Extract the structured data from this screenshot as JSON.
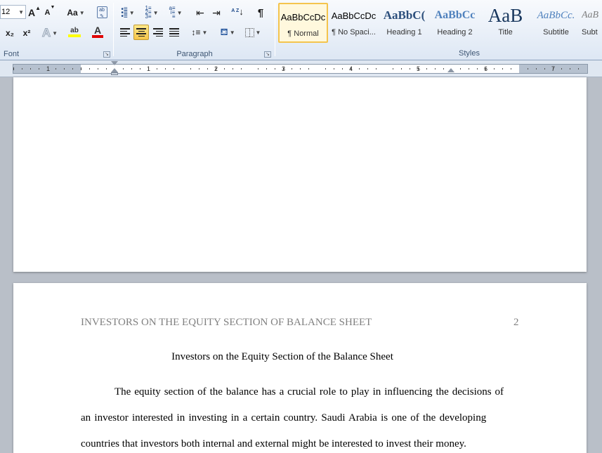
{
  "ribbon": {
    "font_group": {
      "label": "Font",
      "font_size": "12",
      "grow_font": "A",
      "shrink_font": "A",
      "change_case": "Aa",
      "subscript": "x₂",
      "superscript": "x²",
      "highlight_label": "ab",
      "font_color_label": "A",
      "highlight_color": "#ffff00",
      "font_color": "#e00000"
    },
    "paragraph_group": {
      "label": "Paragraph",
      "sort_label": "A Z",
      "show_marks": "¶"
    },
    "styles_group": {
      "label": "Styles",
      "items": [
        {
          "preview": "AaBbCcDc",
          "name": "¶ Normal"
        },
        {
          "preview": "AaBbCcDc",
          "name": "¶ No Spaci..."
        },
        {
          "preview": "AaBbC(",
          "name": "Heading 1"
        },
        {
          "preview": "AaBbCc",
          "name": "Heading 2"
        },
        {
          "preview": "AaB",
          "name": "Title"
        },
        {
          "preview": "AaBbCc.",
          "name": "Subtitle"
        },
        {
          "preview": "AaB",
          "name": "Subt"
        }
      ]
    }
  },
  "ruler": {
    "numbers": [
      "1",
      "1",
      "2",
      "3",
      "4",
      "5",
      "6",
      "7"
    ]
  },
  "document": {
    "running_head": "INVESTORS ON THE EQUITY SECTION OF BALANCE SHEET",
    "page_number": "2",
    "title": "Investors on the Equity Section of the Balance Sheet",
    "lines": [
      "The equity section of the balance has a crucial role to play in influencing the decisions of",
      "an investor interested in investing in a certain country. Saudi Arabia is one of the developing",
      "countries that investors both internal and external might be interested to invest their money."
    ]
  }
}
